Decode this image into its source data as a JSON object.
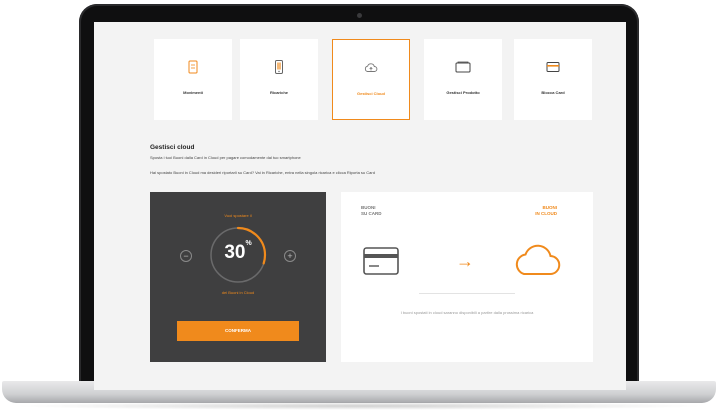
{
  "tabs": [
    {
      "label": "Movimenti",
      "icon": "document-icon",
      "active": false
    },
    {
      "label": "Ricariche",
      "icon": "phone-icon",
      "active": false
    },
    {
      "label": "Gestisci Cloud",
      "icon": "cloud-upload-icon",
      "active": true
    },
    {
      "label": "Gestisci Prodotto",
      "icon": "wallet-icon",
      "active": false
    },
    {
      "label": "Blocca Card",
      "icon": "card-lock-icon",
      "active": false
    }
  ],
  "section": {
    "title": "Gestisci cloud",
    "description": "Sposta i tuoi Buoni dalla Card in Cloud per pagare comodamente dal tuo smartphone",
    "note": "Hai spostato Buoni in Cloud ma desideri riportarli su Card? Vai in Ricariche, entra nella singola ricarica e clicca Riporta su Card"
  },
  "cloud_control": {
    "label_top": "Vuoi spostare il",
    "percent_value": "30",
    "percent_unit": "%",
    "fill_fraction": 0.3,
    "minus": "−",
    "plus": "+",
    "label_bottom": "dei Buoni in Cloud",
    "confirm_label": "CONFERMA"
  },
  "illustration": {
    "left_label_line1": "BUONI",
    "left_label_line2": "SU CARD",
    "right_label_line1": "BUONI",
    "right_label_line2": "IN CLOUD",
    "arrow": "→",
    "caption": "I buoni spostati in cloud saranno disponibili a partire dalla prossima ricarica"
  },
  "colors": {
    "accent": "#f08a1c",
    "dark_panel": "#3f3f40",
    "screen_bg": "#f3f3f3"
  }
}
